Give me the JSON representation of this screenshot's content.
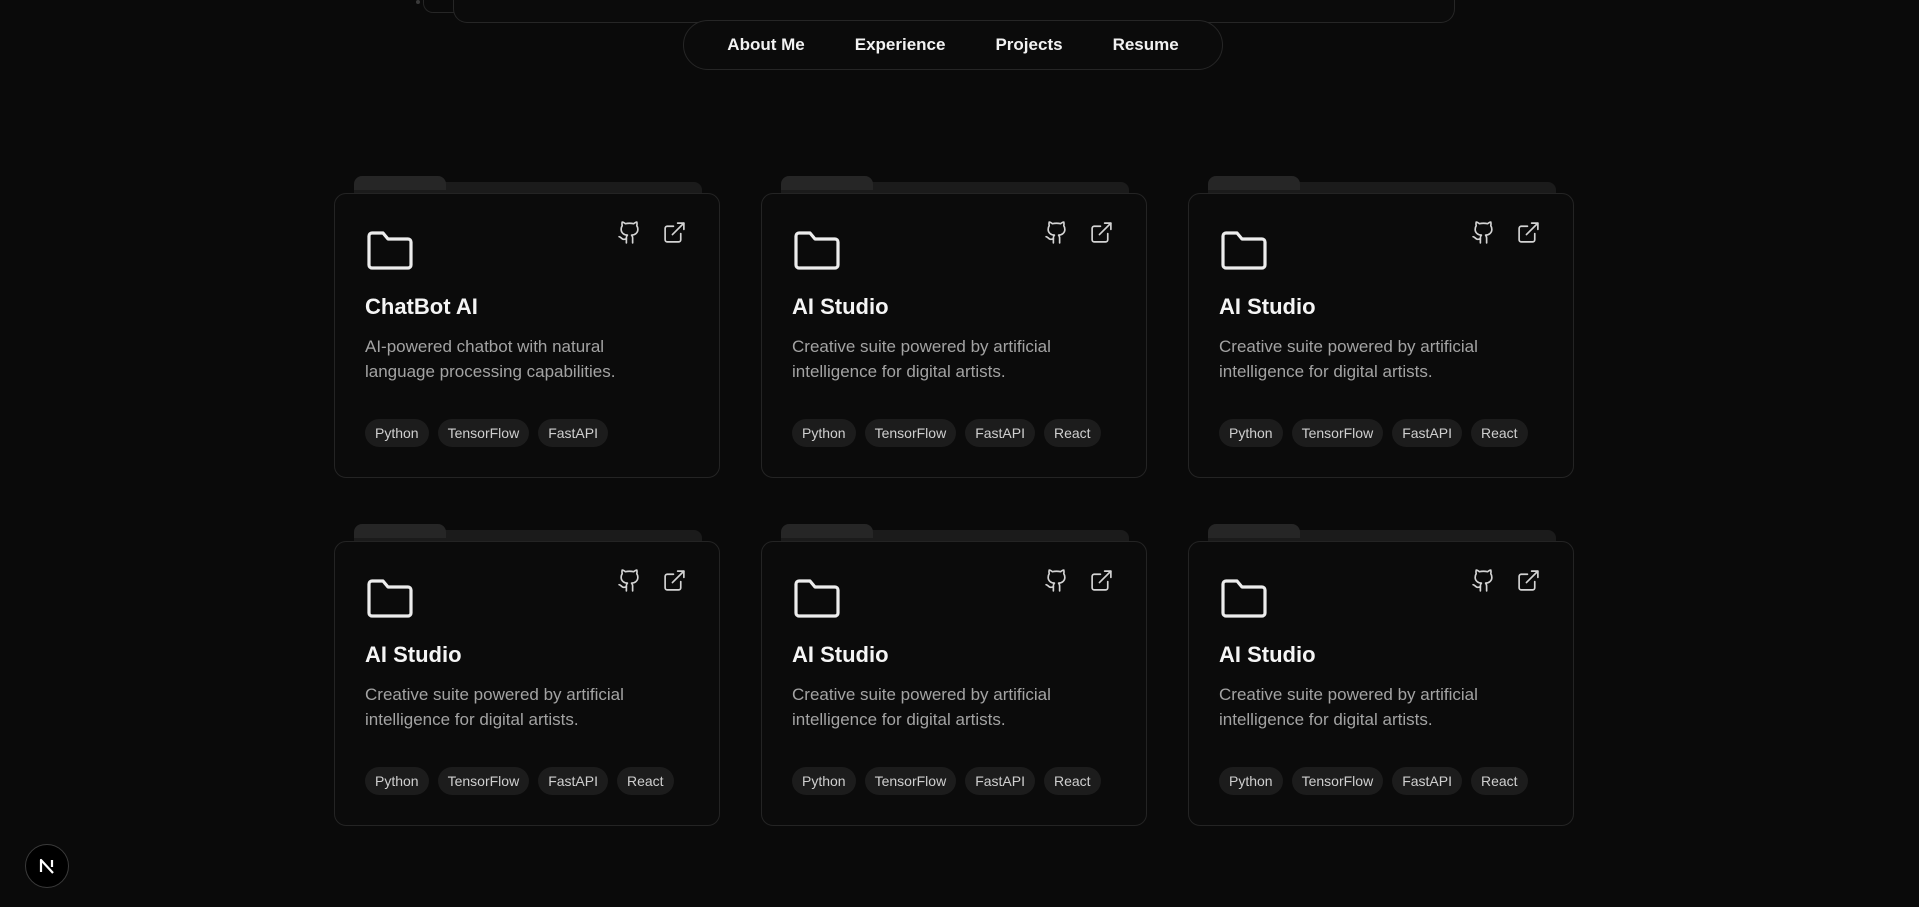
{
  "nav": {
    "items": [
      "About Me",
      "Experience",
      "Projects",
      "Resume"
    ]
  },
  "projects": [
    {
      "title": "ChatBot AI",
      "description": "AI-powered chatbot with natural language processing capabilities.",
      "tags": [
        "Python",
        "TensorFlow",
        "FastAPI"
      ]
    },
    {
      "title": "AI Studio",
      "description": "Creative suite powered by artificial intelligence for digital artists.",
      "tags": [
        "Python",
        "TensorFlow",
        "FastAPI",
        "React"
      ]
    },
    {
      "title": "AI Studio",
      "description": "Creative suite powered by artificial intelligence for digital artists.",
      "tags": [
        "Python",
        "TensorFlow",
        "FastAPI",
        "React"
      ]
    },
    {
      "title": "AI Studio",
      "description": "Creative suite powered by artificial intelligence for digital artists.",
      "tags": [
        "Python",
        "TensorFlow",
        "FastAPI",
        "React"
      ]
    },
    {
      "title": "AI Studio",
      "description": "Creative suite powered by artificial intelligence for digital artists.",
      "tags": [
        "Python",
        "TensorFlow",
        "FastAPI",
        "React"
      ]
    },
    {
      "title": "AI Studio",
      "description": "Creative suite powered by artificial intelligence for digital artists.",
      "tags": [
        "Python",
        "TensorFlow",
        "FastAPI",
        "React"
      ]
    }
  ],
  "icons": {
    "folder": "folder-icon",
    "repo": "github-icon",
    "external": "external-link-icon",
    "badge": "nextjs-icon"
  },
  "badge": {
    "letter": "N"
  },
  "colors": {
    "background": "#0a0a0a",
    "card_border": "#242424",
    "tag_bg": "#1c1c1c",
    "muted_text": "#a3a3a3"
  }
}
